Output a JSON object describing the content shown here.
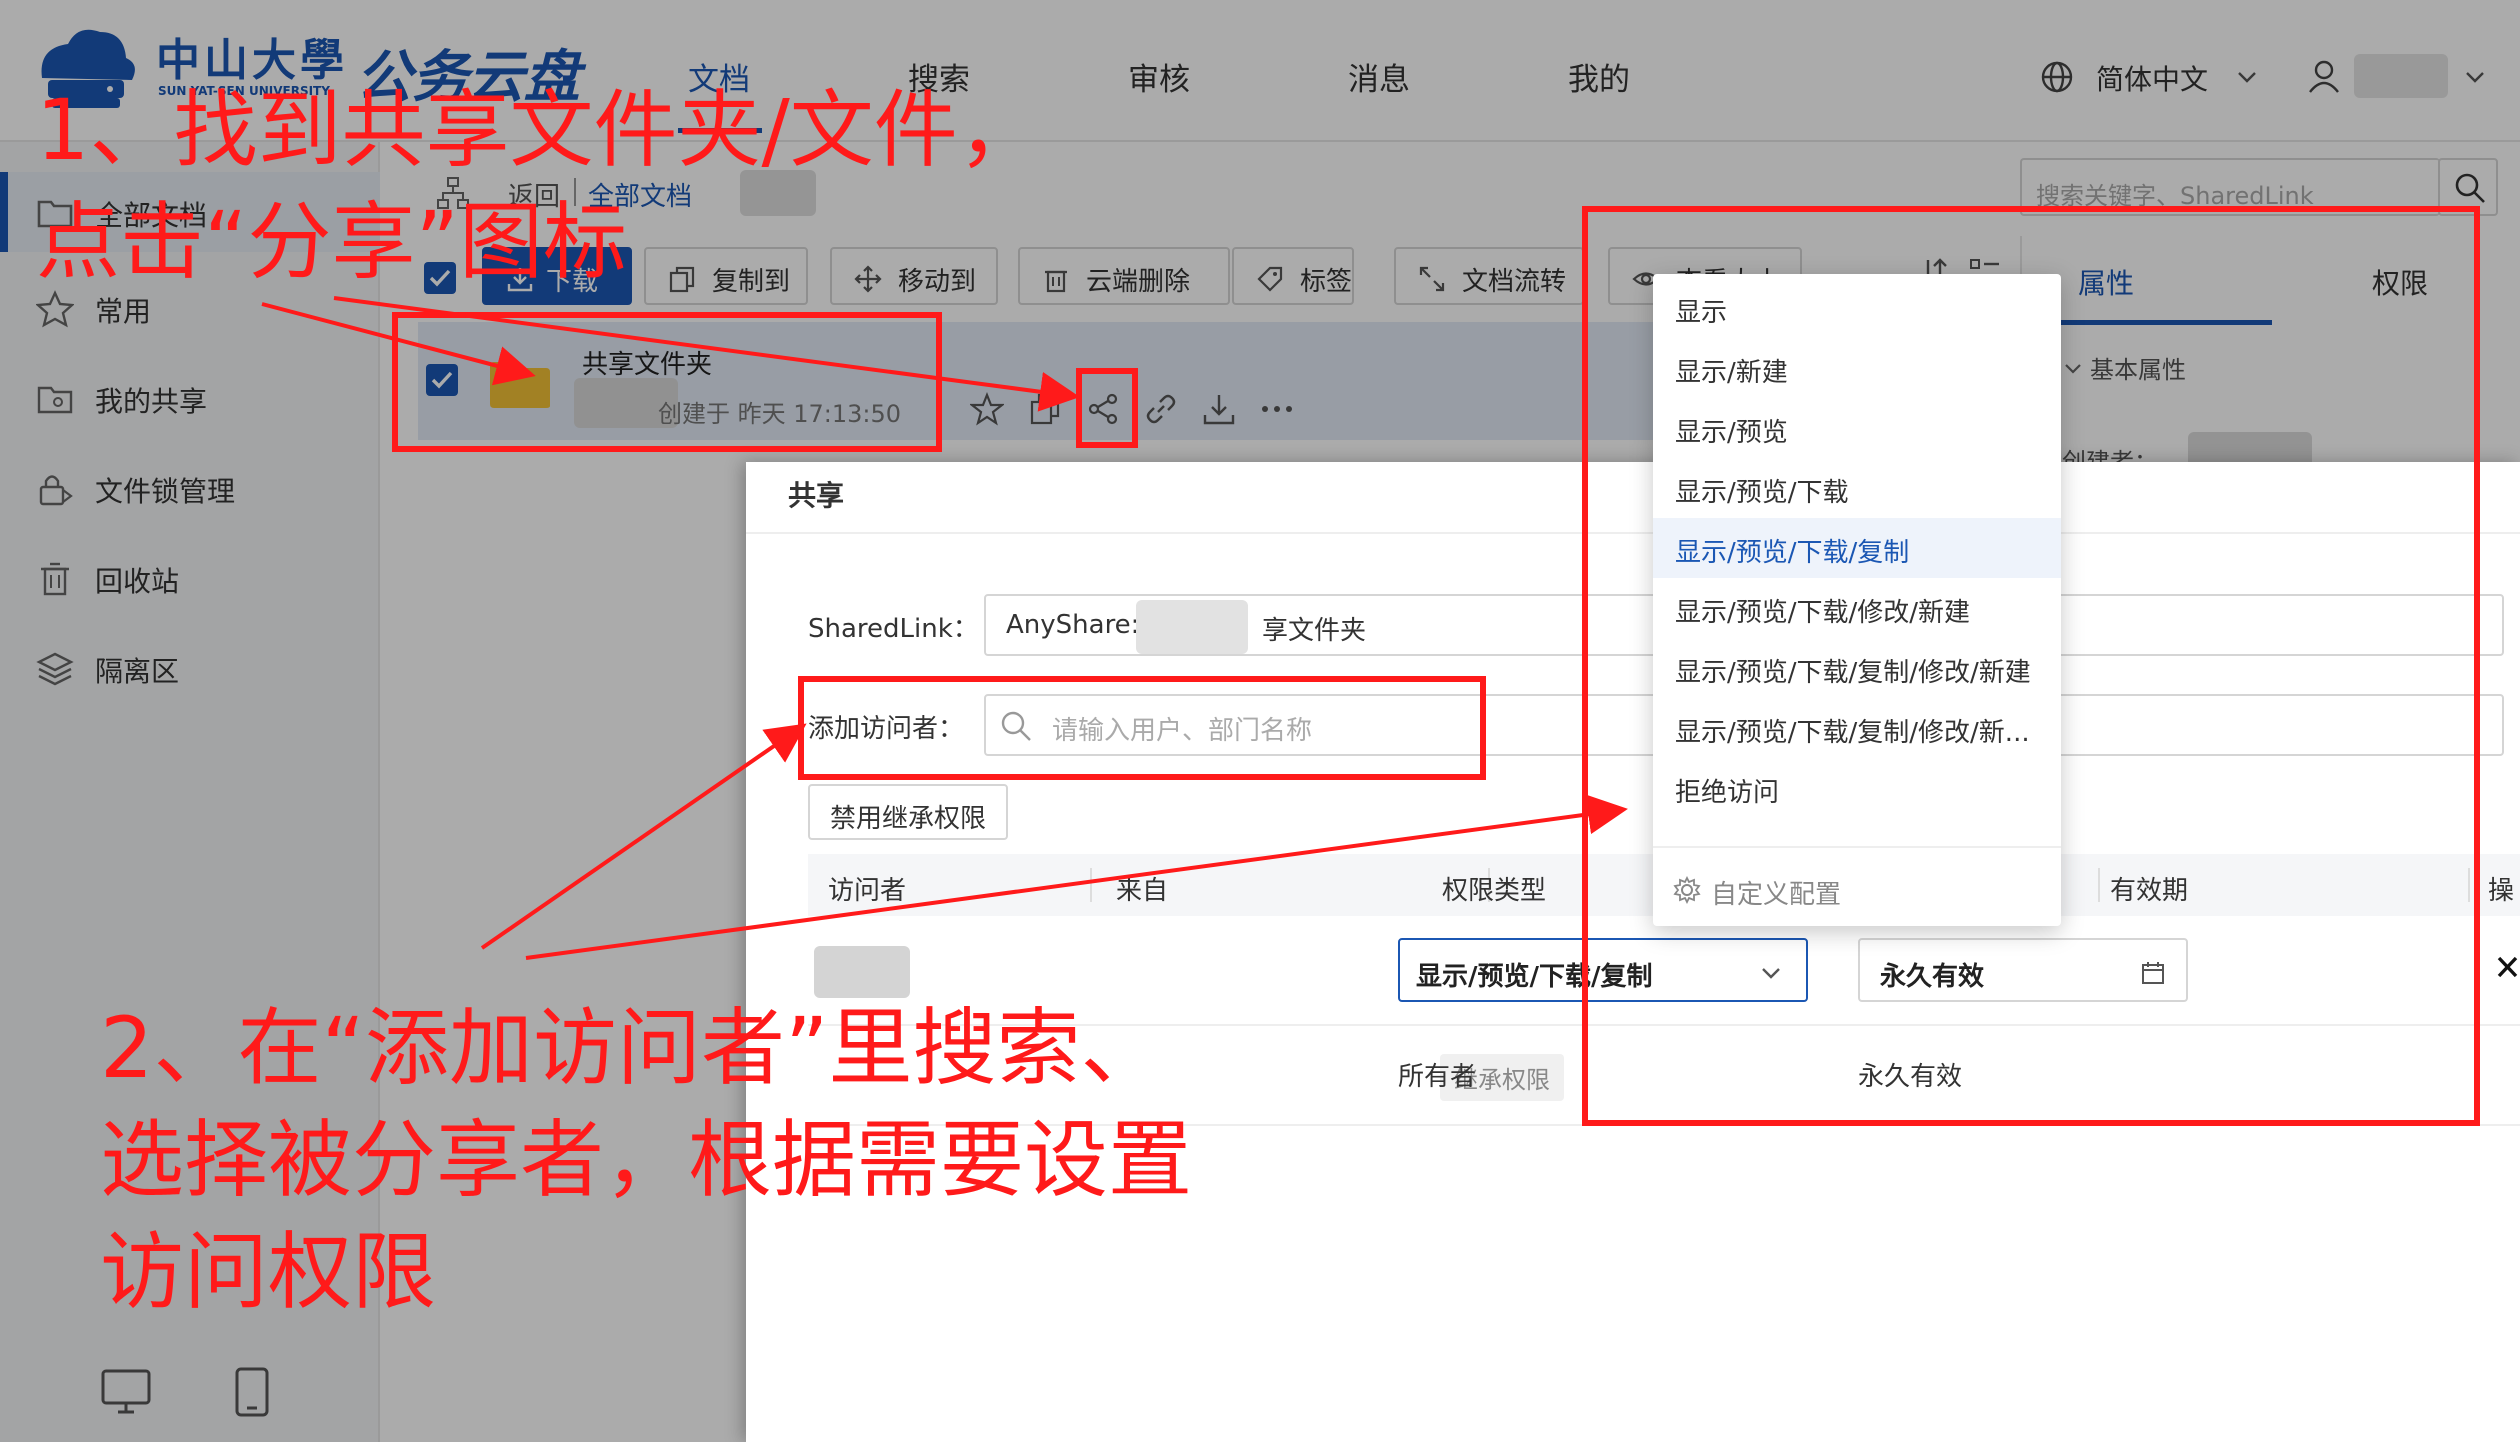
{
  "header": {
    "logo_name_cn": "中山大學",
    "logo_name_en": "SUN YAT-SEN UNIVERSITY",
    "product": "公务云盘",
    "nav": [
      "文档",
      "搜索",
      "审核",
      "消息",
      "我的"
    ],
    "language": "简体中文"
  },
  "sidebar": {
    "items": [
      "全部文档",
      "常用",
      "我的共享",
      "文件锁管理",
      "回收站",
      "隔离区"
    ]
  },
  "breadcrumb": {
    "back": "返回",
    "root": "全部文档"
  },
  "search": {
    "placeholder": "搜索关键字、SharedLink"
  },
  "toolbar": {
    "buttons": [
      "下载",
      "复制到",
      "移动到",
      "云端删除",
      "标签",
      "文档流转",
      "查看大小"
    ]
  },
  "file": {
    "name": "共享文件夹",
    "created": "创建于 昨天 17:13:50"
  },
  "right_panel": {
    "tab_attr": "属性",
    "tab_perm": "权限",
    "basic": "基本属性",
    "creator_label": "创建者："
  },
  "dialog": {
    "title": "共享",
    "sharedlink_label": "SharedLink：",
    "sharedlink_prefix": "AnyShare:",
    "sharedlink_suffix": "享文件夹",
    "add_label": "添加访问者：",
    "add_placeholder": "请输入用户、部门名称",
    "disable_inherit": "禁用继承权限",
    "columns": [
      "访问者",
      "来自",
      "权限类型",
      "有效期",
      "操"
    ],
    "row1": {
      "permission": "显示/预览/下载/复制",
      "validity": "永久有效"
    },
    "row2": {
      "badge": "继承权限",
      "type": "所有者",
      "validity": "永久有效"
    }
  },
  "dropdown": {
    "options": [
      "显示",
      "显示/新建",
      "显示/预览",
      "显示/预览/下载",
      "显示/预览/下载/复制",
      "显示/预览/下载/修改/新建",
      "显示/预览/下载/复制/修改/新建",
      "显示/预览/下载/复制/修改/新...",
      "拒绝访问"
    ],
    "selected_index": 4,
    "custom": "自定义配置"
  },
  "annotations": {
    "step1_line1": "1、找到共享文件夹/文件，",
    "step1_line2": "点击“分享”图标",
    "step2_line1": "2、在“添加访问者”里搜索、",
    "step2_line2": "选择被分享者，根据需要设置",
    "step2_line3": "访问权限"
  },
  "colors": {
    "brand": "#1b57b3",
    "annotation": "#ff1a1a",
    "overlay": "rgba(0,0,0,0.33)"
  }
}
